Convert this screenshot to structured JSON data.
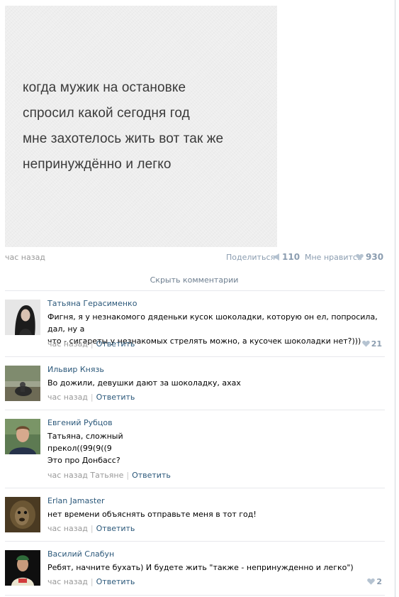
{
  "post": {
    "text_lines": [
      "когда мужик на остановке",
      "спросил какой сегодня год",
      "мне захотелось жить вот так же",
      "непринуждённо и легко"
    ],
    "time": "час назад",
    "share_label": "Поделиться",
    "share_count": "110",
    "like_label": "Мне нравится",
    "like_count": "930"
  },
  "hide_comments_label": "Скрыть комментарии",
  "comments": [
    {
      "author": "Татьяна Герасименко",
      "text_lines": [
        "Фигня, я у незнакомого дяденьки кусок шоколадки, которую он ел, попросила, дал, ну а",
        "что - сигареты у незнакомых стрелять можно, а кусочек шоколадки нет?)))"
      ],
      "time": "час назад",
      "reply_label": "Ответить",
      "likes": "21"
    },
    {
      "author": "Ильвир Князь",
      "text_lines": [
        "Во дожили, девушки дают за шоколадку, ахах"
      ],
      "time": "час назад",
      "reply_label": "Ответить"
    },
    {
      "author": "Евгений Рубцов",
      "text_lines": [
        "Татьяна, сложный",
        "прекол((99(9((9",
        "Это про Донбасс?"
      ],
      "time": "час назад Татьяне",
      "reply_label": "Ответить"
    },
    {
      "author": "Erlan Jamaster",
      "text_lines": [
        "нет времени объяснять отправьте меня в тот год!"
      ],
      "time": "час назад",
      "reply_label": "Ответить"
    },
    {
      "author": "Василий Слабун",
      "text_lines": [
        "Ребят, начните бухать) И будете жить \"также - непринужденно и легко\")"
      ],
      "time": "час назад",
      "reply_label": "Ответить",
      "likes": "2"
    }
  ],
  "colors": {
    "link": "#2b587a",
    "muted": "#999999",
    "counter": "#8b9db0"
  }
}
